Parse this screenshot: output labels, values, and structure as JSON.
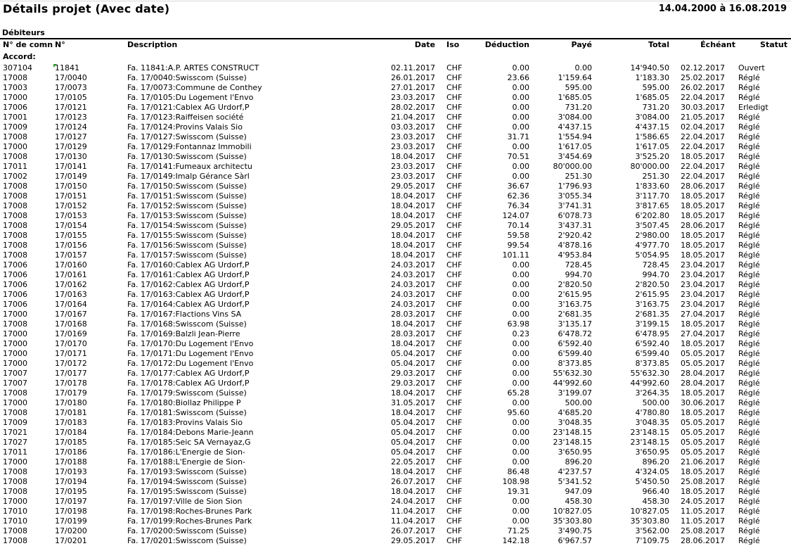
{
  "report": {
    "title": "Détails projet (Avec date)",
    "date_range": "14.04.2000 à 16.08.2019",
    "section": "Débiteurs",
    "group_label": "Accord:"
  },
  "columns": {
    "client": "N° de comn",
    "no": "N°",
    "description": "Description",
    "date": "Date",
    "iso": "Iso",
    "deduction": "Déduction",
    "paye": "Payé",
    "total": "Total",
    "echeant": "Échéant",
    "statut": "Statut"
  },
  "rows": [
    [
      "307104",
      "11841",
      "Fa. 11841:A.P. ARTES CONSTRUCT",
      "02.11.2017",
      "CHF",
      "0.00",
      "0.00",
      "14'940.50",
      "02.12.2017",
      "Ouvert"
    ],
    [
      "17008",
      "17/0040",
      "Fa. 17/0040:Swisscom (Suisse)",
      "26.01.2017",
      "CHF",
      "23.66",
      "1'159.64",
      "1'183.30",
      "25.02.2017",
      "Réglé"
    ],
    [
      "17003",
      "17/0073",
      "Fa. 17/0073:Commune de Conthey",
      "27.01.2017",
      "CHF",
      "0.00",
      "595.00",
      "595.00",
      "26.02.2017",
      "Réglé"
    ],
    [
      "17000",
      "17/0105",
      "Fa. 17/0105:Du Logement l'Envo",
      "23.03.2017",
      "CHF",
      "0.00",
      "1'685.05",
      "1'685.05",
      "22.04.2017",
      "Réglé"
    ],
    [
      "17006",
      "17/0121",
      "Fa. 17/0121:Cablex AG Urdorf,P",
      "28.02.2017",
      "CHF",
      "0.00",
      "731.20",
      "731.20",
      "30.03.2017",
      "Erledigt"
    ],
    [
      "17001",
      "17/0123",
      "Fa. 17/0123:Raiffeisen société",
      "21.04.2017",
      "CHF",
      "0.00",
      "3'084.00",
      "3'084.00",
      "21.05.2017",
      "Réglé"
    ],
    [
      "17009",
      "17/0124",
      "Fa. 17/0124:Provins Valais Sio",
      "03.03.2017",
      "CHF",
      "0.00",
      "4'437.15",
      "4'437.15",
      "02.04.2017",
      "Réglé"
    ],
    [
      "17008",
      "17/0127",
      "Fa. 17/0127:Swisscom (Suisse)",
      "23.03.2017",
      "CHF",
      "31.71",
      "1'554.94",
      "1'586.65",
      "22.04.2017",
      "Réglé"
    ],
    [
      "17000",
      "17/0129",
      "Fa. 17/0129:Fontannaz Immobili",
      "23.03.2017",
      "CHF",
      "0.00",
      "1'617.05",
      "1'617.05",
      "22.04.2017",
      "Réglé"
    ],
    [
      "17008",
      "17/0130",
      "Fa. 17/0130:Swisscom (Suisse)",
      "18.04.2017",
      "CHF",
      "70.51",
      "3'454.69",
      "3'525.20",
      "18.05.2017",
      "Réglé"
    ],
    [
      "17011",
      "17/0141",
      "Fa. 17/0141:Fumeaux architectu",
      "23.03.2017",
      "CHF",
      "0.00",
      "80'000.00",
      "80'000.00",
      "22.04.2017",
      "Réglé"
    ],
    [
      "17002",
      "17/0149",
      "Fa. 17/0149:Imalp Gérance Sàrl",
      "23.03.2017",
      "CHF",
      "0.00",
      "251.30",
      "251.30",
      "22.04.2017",
      "Réglé"
    ],
    [
      "17008",
      "17/0150",
      "Fa. 17/0150:Swisscom (Suisse)",
      "29.05.2017",
      "CHF",
      "36.67",
      "1'796.93",
      "1'833.60",
      "28.06.2017",
      "Réglé"
    ],
    [
      "17008",
      "17/0151",
      "Fa. 17/0151:Swisscom (Suisse)",
      "18.04.2017",
      "CHF",
      "62.36",
      "3'055.34",
      "3'117.70",
      "18.05.2017",
      "Réglé"
    ],
    [
      "17008",
      "17/0152",
      "Fa. 17/0152:Swisscom (Suisse)",
      "18.04.2017",
      "CHF",
      "76.34",
      "3'741.31",
      "3'817.65",
      "18.05.2017",
      "Réglé"
    ],
    [
      "17008",
      "17/0153",
      "Fa. 17/0153:Swisscom (Suisse)",
      "18.04.2017",
      "CHF",
      "124.07",
      "6'078.73",
      "6'202.80",
      "18.05.2017",
      "Réglé"
    ],
    [
      "17008",
      "17/0154",
      "Fa. 17/0154:Swisscom (Suisse)",
      "29.05.2017",
      "CHF",
      "70.14",
      "3'437.31",
      "3'507.45",
      "28.06.2017",
      "Réglé"
    ],
    [
      "17008",
      "17/0155",
      "Fa. 17/0155:Swisscom (Suisse)",
      "18.04.2017",
      "CHF",
      "59.58",
      "2'920.42",
      "2'980.00",
      "18.05.2017",
      "Réglé"
    ],
    [
      "17008",
      "17/0156",
      "Fa. 17/0156:Swisscom (Suisse)",
      "18.04.2017",
      "CHF",
      "99.54",
      "4'878.16",
      "4'977.70",
      "18.05.2017",
      "Réglé"
    ],
    [
      "17008",
      "17/0157",
      "Fa. 17/0157:Swisscom (Suisse)",
      "18.04.2017",
      "CHF",
      "101.11",
      "4'953.84",
      "5'054.95",
      "18.05.2017",
      "Réglé"
    ],
    [
      "17006",
      "17/0160",
      "Fa. 17/0160:Cablex AG Urdorf,P",
      "24.03.2017",
      "CHF",
      "0.00",
      "728.45",
      "728.45",
      "23.04.2017",
      "Réglé"
    ],
    [
      "17006",
      "17/0161",
      "Fa. 17/0161:Cablex AG Urdorf,P",
      "24.03.2017",
      "CHF",
      "0.00",
      "994.70",
      "994.70",
      "23.04.2017",
      "Réglé"
    ],
    [
      "17006",
      "17/0162",
      "Fa. 17/0162:Cablex AG Urdorf,P",
      "24.03.2017",
      "CHF",
      "0.00",
      "2'820.50",
      "2'820.50",
      "23.04.2017",
      "Réglé"
    ],
    [
      "17006",
      "17/0163",
      "Fa. 17/0163:Cablex AG Urdorf,P",
      "24.03.2017",
      "CHF",
      "0.00",
      "2'615.95",
      "2'615.95",
      "23.04.2017",
      "Réglé"
    ],
    [
      "17006",
      "17/0164",
      "Fa. 17/0164:Cablex AG Urdorf,P",
      "24.03.2017",
      "CHF",
      "0.00",
      "3'163.75",
      "3'163.75",
      "23.04.2017",
      "Réglé"
    ],
    [
      "17000",
      "17/0167",
      "Fa. 17/0167:Flactions Vins SA",
      "28.03.2017",
      "CHF",
      "0.00",
      "2'681.35",
      "2'681.35",
      "27.04.2017",
      "Réglé"
    ],
    [
      "17008",
      "17/0168",
      "Fa. 17/0168:Swisscom (Suisse)",
      "18.04.2017",
      "CHF",
      "63.98",
      "3'135.17",
      "3'199.15",
      "18.05.2017",
      "Réglé"
    ],
    [
      "17000",
      "17/0169",
      "Fa. 17/0169:Balzli Jean-Pierre",
      "28.03.2017",
      "CHF",
      "0.23",
      "6'478.72",
      "6'478.95",
      "27.04.2017",
      "Réglé"
    ],
    [
      "17000",
      "17/0170",
      "Fa. 17/0170:Du Logement l'Envo",
      "18.04.2017",
      "CHF",
      "0.00",
      "6'592.40",
      "6'592.40",
      "18.05.2017",
      "Réglé"
    ],
    [
      "17000",
      "17/0171",
      "Fa. 17/0171:Du Logement l'Envo",
      "05.04.2017",
      "CHF",
      "0.00",
      "6'599.40",
      "6'599.40",
      "05.05.2017",
      "Réglé"
    ],
    [
      "17000",
      "17/0172",
      "Fa. 17/0172:Du Logement l'Envo",
      "05.04.2017",
      "CHF",
      "0.00",
      "8'373.85",
      "8'373.85",
      "05.05.2017",
      "Réglé"
    ],
    [
      "17007",
      "17/0177",
      "Fa. 17/0177:Cablex AG Urdorf,P",
      "29.03.2017",
      "CHF",
      "0.00",
      "55'632.30",
      "55'632.30",
      "28.04.2017",
      "Réglé"
    ],
    [
      "17007",
      "17/0178",
      "Fa. 17/0178:Cablex AG Urdorf,P",
      "29.03.2017",
      "CHF",
      "0.00",
      "44'992.60",
      "44'992.60",
      "28.04.2017",
      "Réglé"
    ],
    [
      "17008",
      "17/0179",
      "Fa. 17/0179:Swisscom (Suisse)",
      "18.04.2017",
      "CHF",
      "65.28",
      "3'199.07",
      "3'264.35",
      "18.05.2017",
      "Réglé"
    ],
    [
      "17000",
      "17/0180",
      "Fa. 17/0180:Biollaz Philippe P",
      "31.05.2017",
      "CHF",
      "0.00",
      "500.00",
      "500.00",
      "30.06.2017",
      "Réglé"
    ],
    [
      "17008",
      "17/0181",
      "Fa. 17/0181:Swisscom (Suisse)",
      "18.04.2017",
      "CHF",
      "95.60",
      "4'685.20",
      "4'780.80",
      "18.05.2017",
      "Réglé"
    ],
    [
      "17009",
      "17/0183",
      "Fa. 17/0183:Provins Valais Sio",
      "05.04.2017",
      "CHF",
      "0.00",
      "3'048.35",
      "3'048.35",
      "05.05.2017",
      "Réglé"
    ],
    [
      "17021",
      "17/0184",
      "Fa. 17/0184:Debons Marie-Jeann",
      "05.04.2017",
      "CHF",
      "0.00",
      "23'148.15",
      "23'148.15",
      "05.05.2017",
      "Réglé"
    ],
    [
      "17027",
      "17/0185",
      "Fa. 17/0185:Seic SA Vernayaz,G",
      "05.04.2017",
      "CHF",
      "0.00",
      "23'148.15",
      "23'148.15",
      "05.05.2017",
      "Réglé"
    ],
    [
      "17011",
      "17/0186",
      "Fa. 17/0186:L'Energie de Sion-",
      "05.04.2017",
      "CHF",
      "0.00",
      "3'650.95",
      "3'650.95",
      "05.05.2017",
      "Réglé"
    ],
    [
      "17000",
      "17/0188",
      "Fa. 17/0188:L'Energie de Sion-",
      "22.05.2017",
      "CHF",
      "0.00",
      "896.20",
      "896.20",
      "21.06.2017",
      "Réglé"
    ],
    [
      "17008",
      "17/0193",
      "Fa. 17/0193:Swisscom (Suisse)",
      "18.04.2017",
      "CHF",
      "86.48",
      "4'237.57",
      "4'324.05",
      "18.05.2017",
      "Réglé"
    ],
    [
      "17008",
      "17/0194",
      "Fa. 17/0194:Swisscom (Suisse)",
      "26.07.2017",
      "CHF",
      "108.98",
      "5'341.52",
      "5'450.50",
      "25.08.2017",
      "Réglé"
    ],
    [
      "17008",
      "17/0195",
      "Fa. 17/0195:Swisscom (Suisse)",
      "18.04.2017",
      "CHF",
      "19.31",
      "947.09",
      "966.40",
      "18.05.2017",
      "Réglé"
    ],
    [
      "17000",
      "17/0197",
      "Fa. 17/0197:Ville de Sion Sion",
      "24.04.2017",
      "CHF",
      "0.00",
      "458.30",
      "458.30",
      "24.05.2017",
      "Réglé"
    ],
    [
      "17010",
      "17/0198",
      "Fa. 17/0198:Roches-Brunes Park",
      "11.04.2017",
      "CHF",
      "0.00",
      "10'827.05",
      "10'827.05",
      "11.05.2017",
      "Réglé"
    ],
    [
      "17010",
      "17/0199",
      "Fa. 17/0199:Roches-Brunes Park",
      "11.04.2017",
      "CHF",
      "0.00",
      "35'303.80",
      "35'303.80",
      "11.05.2017",
      "Réglé"
    ],
    [
      "17008",
      "17/0200",
      "Fa. 17/0200:Swisscom (Suisse)",
      "26.07.2017",
      "CHF",
      "71.25",
      "3'490.75",
      "3'562.00",
      "25.08.2017",
      "Réglé"
    ],
    [
      "17008",
      "17/0201",
      "Fa. 17/0201:Swisscom (Suisse)",
      "29.05.2017",
      "CHF",
      "142.18",
      "6'967.57",
      "7'109.75",
      "28.06.2017",
      "Réglé"
    ]
  ]
}
